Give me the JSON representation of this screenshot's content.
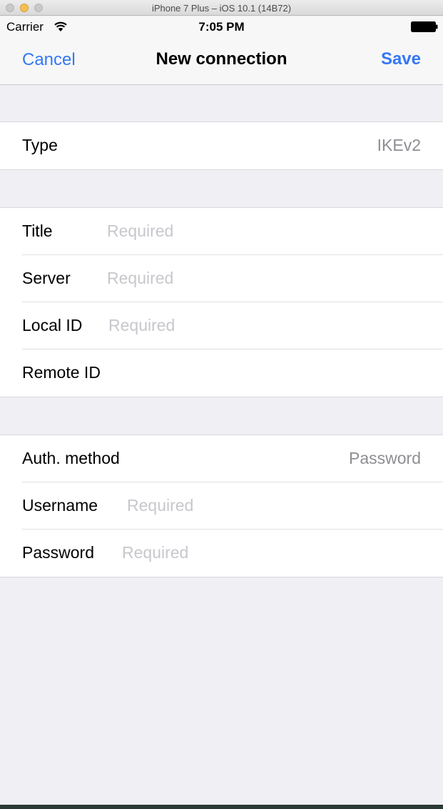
{
  "simulator": {
    "title": "iPhone 7 Plus – iOS 10.1 (14B72)"
  },
  "status_bar": {
    "carrier": "Carrier",
    "time": "7:05 PM",
    "wifi_icon": "wifi-icon",
    "battery_icon": "battery-icon"
  },
  "nav": {
    "cancel": "Cancel",
    "title": "New connection",
    "save": "Save",
    "accent": "#3478f6"
  },
  "sections": {
    "type": {
      "label": "Type",
      "value": "IKEv2"
    },
    "server": {
      "title_label": "Title",
      "title_placeholder": "Required",
      "server_label": "Server",
      "server_placeholder": "Required",
      "local_id_label": "Local ID",
      "local_id_placeholder": "Required",
      "remote_id_label": "Remote ID"
    },
    "auth": {
      "method_label": "Auth. method",
      "method_value": "Password",
      "username_label": "Username",
      "username_placeholder": "Required",
      "password_label": "Password",
      "password_placeholder": "Required"
    }
  }
}
